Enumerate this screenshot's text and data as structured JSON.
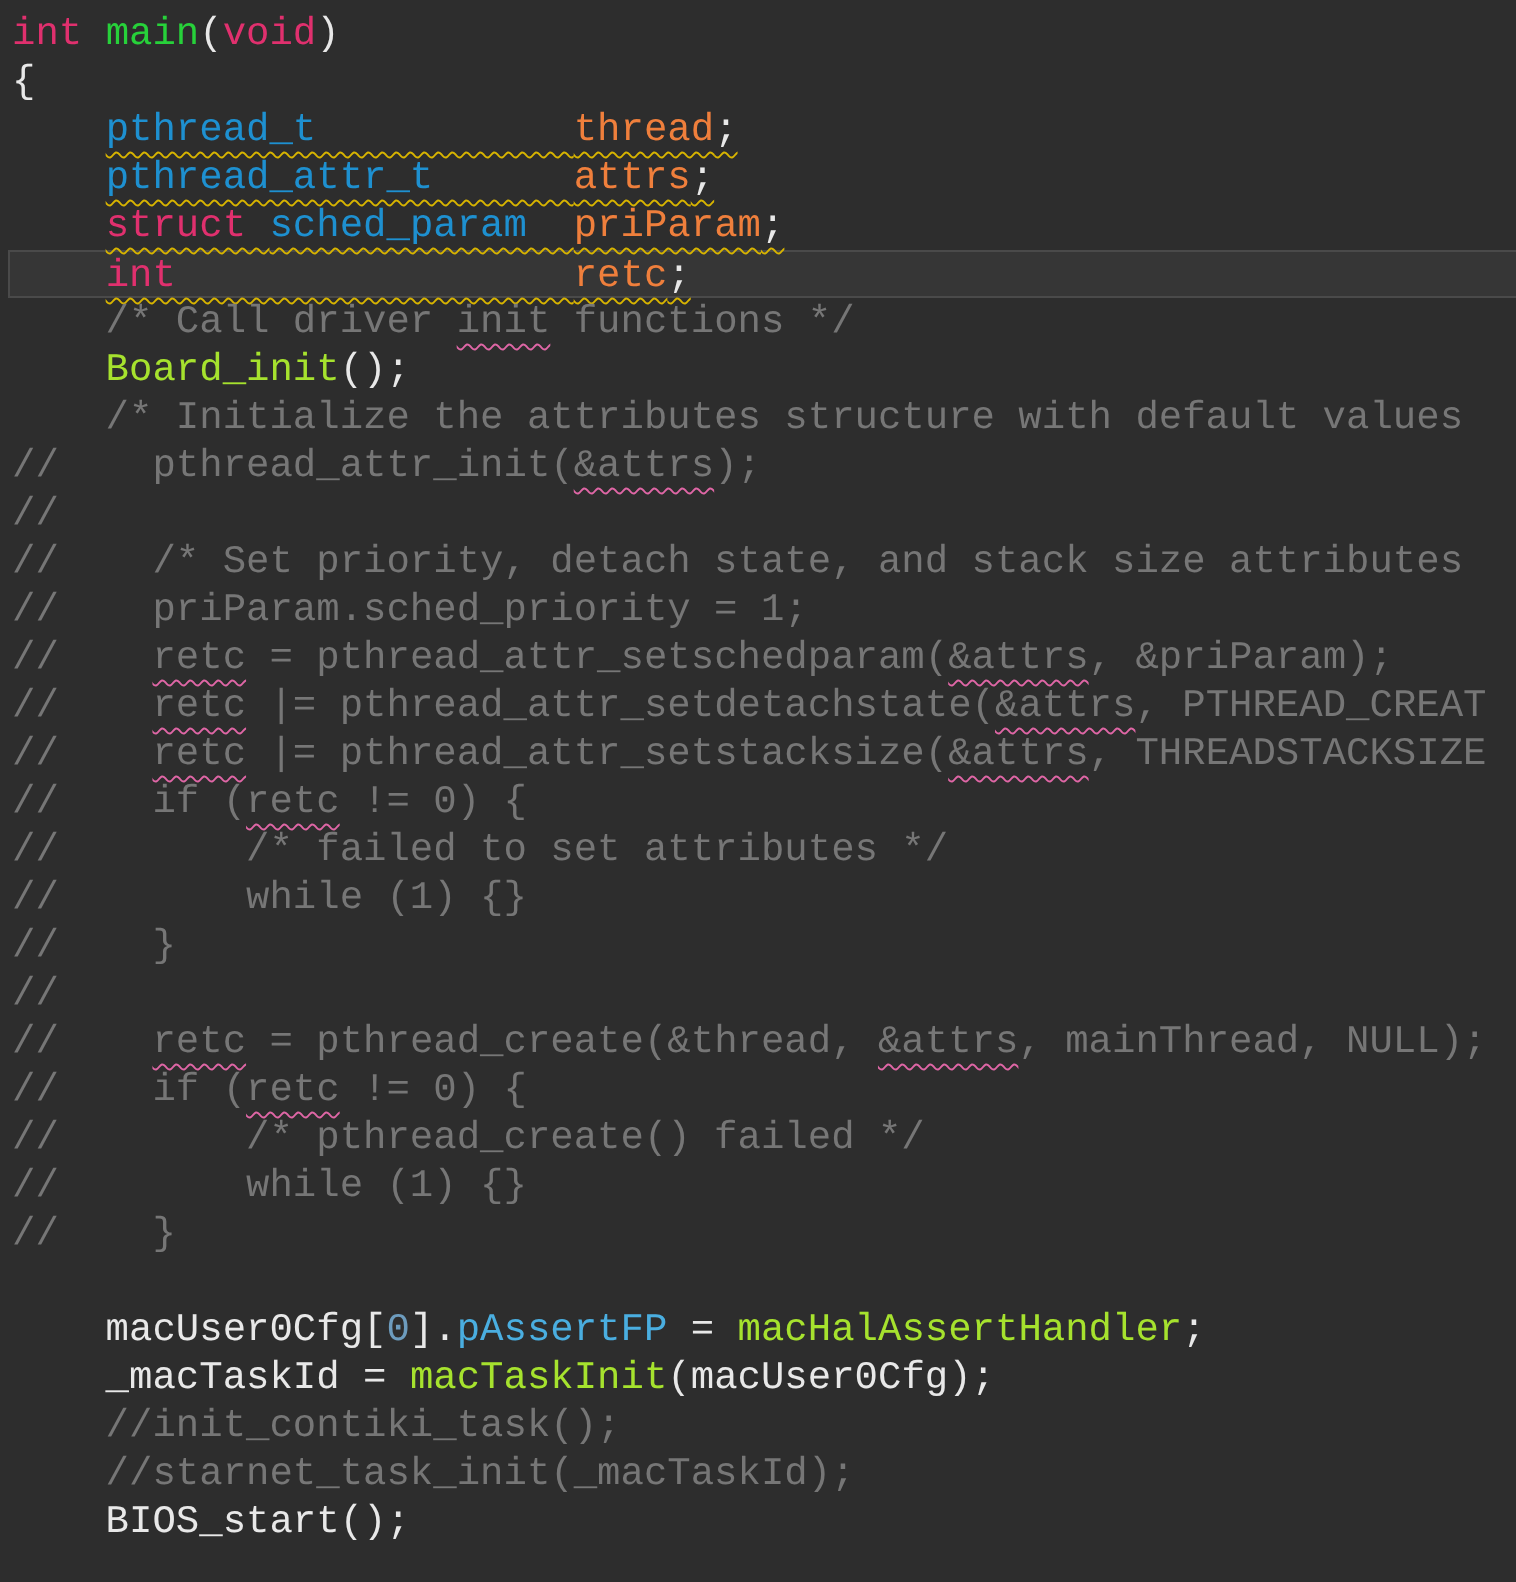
{
  "editor": {
    "lines": [
      {
        "current": false,
        "tokens": [
          {
            "text": "int ",
            "kind": "keyword"
          },
          {
            "text": "main",
            "kind": "definition"
          },
          {
            "text": "(",
            "kind": "plain"
          },
          {
            "text": "void",
            "kind": "keyword"
          },
          {
            "text": ")",
            "kind": "plain"
          }
        ]
      },
      {
        "current": false,
        "tokens": [
          {
            "text": "{",
            "kind": "plain"
          }
        ]
      },
      {
        "current": false,
        "warning": true,
        "tokens": [
          {
            "text": "    pthread_t           ",
            "kind": "type"
          },
          {
            "text": "thread",
            "kind": "variable"
          },
          {
            "text": ";",
            "kind": "plain"
          }
        ]
      },
      {
        "current": false,
        "warning": true,
        "tokens": [
          {
            "text": "    pthread_attr_t      ",
            "kind": "type"
          },
          {
            "text": "attrs",
            "kind": "variable"
          },
          {
            "text": ";",
            "kind": "plain"
          }
        ]
      },
      {
        "current": false,
        "warning": true,
        "tokens": [
          {
            "text": "    struct ",
            "kind": "keyword"
          },
          {
            "text": "sched_param  ",
            "kind": "type"
          },
          {
            "text": "priParam",
            "kind": "variable"
          },
          {
            "text": ";",
            "kind": "plain"
          }
        ]
      },
      {
        "current": true,
        "warning": true,
        "tokens": [
          {
            "text": "    int                 ",
            "kind": "keyword"
          },
          {
            "text": "retc",
            "kind": "variable"
          },
          {
            "text": ";",
            "kind": "plain"
          }
        ]
      },
      {
        "current": false,
        "tokens": [
          {
            "text": "    /* Call driver ",
            "kind": "comment"
          },
          {
            "text": "init",
            "kind": "comment",
            "misspelled": true
          },
          {
            "text": " functions */",
            "kind": "comment"
          }
        ]
      },
      {
        "current": false,
        "tokens": [
          {
            "text": "    Board_init",
            "kind": "function"
          },
          {
            "text": "();",
            "kind": "plain"
          }
        ]
      },
      {
        "current": false,
        "tokens": [
          {
            "text": "    /* Initialize the attributes structure with default values",
            "kind": "comment"
          }
        ]
      },
      {
        "current": false,
        "tokens": [
          {
            "text": "//    pthread_attr_init(",
            "kind": "comment"
          },
          {
            "text": "&attrs",
            "kind": "comment",
            "misspelled": true
          },
          {
            "text": ");",
            "kind": "comment"
          }
        ]
      },
      {
        "current": false,
        "tokens": [
          {
            "text": "//",
            "kind": "comment"
          }
        ]
      },
      {
        "current": false,
        "tokens": [
          {
            "text": "//    /* Set priority, detach state, and stack size attributes",
            "kind": "comment"
          }
        ]
      },
      {
        "current": false,
        "tokens": [
          {
            "text": "//    priParam.sched_priority = 1;",
            "kind": "comment"
          }
        ]
      },
      {
        "current": false,
        "tokens": [
          {
            "text": "//    ",
            "kind": "comment"
          },
          {
            "text": "retc",
            "kind": "comment",
            "misspelled": true
          },
          {
            "text": " = pthread_attr_setschedparam(",
            "kind": "comment"
          },
          {
            "text": "&attrs",
            "kind": "comment",
            "misspelled": true
          },
          {
            "text": ", &priParam);",
            "kind": "comment"
          }
        ]
      },
      {
        "current": false,
        "tokens": [
          {
            "text": "//    ",
            "kind": "comment"
          },
          {
            "text": "retc",
            "kind": "comment",
            "misspelled": true
          },
          {
            "text": " |= pthread_attr_setdetachstate(",
            "kind": "comment"
          },
          {
            "text": "&attrs",
            "kind": "comment",
            "misspelled": true
          },
          {
            "text": ", PTHREAD_CREAT",
            "kind": "comment"
          }
        ]
      },
      {
        "current": false,
        "tokens": [
          {
            "text": "//    ",
            "kind": "comment"
          },
          {
            "text": "retc",
            "kind": "comment",
            "misspelled": true
          },
          {
            "text": " |= pthread_attr_setstacksize(",
            "kind": "comment"
          },
          {
            "text": "&attrs",
            "kind": "comment",
            "misspelled": true
          },
          {
            "text": ", THREADSTACKSIZE",
            "kind": "comment"
          }
        ]
      },
      {
        "current": false,
        "tokens": [
          {
            "text": "//    if (",
            "kind": "comment"
          },
          {
            "text": "retc",
            "kind": "comment",
            "misspelled": true
          },
          {
            "text": " != 0) {",
            "kind": "comment"
          }
        ]
      },
      {
        "current": false,
        "tokens": [
          {
            "text": "//        /* failed to set attributes */",
            "kind": "comment"
          }
        ]
      },
      {
        "current": false,
        "tokens": [
          {
            "text": "//        while (1) {}",
            "kind": "comment"
          }
        ]
      },
      {
        "current": false,
        "tokens": [
          {
            "text": "//    }",
            "kind": "comment"
          }
        ]
      },
      {
        "current": false,
        "tokens": [
          {
            "text": "//",
            "kind": "comment"
          }
        ]
      },
      {
        "current": false,
        "tokens": [
          {
            "text": "//    ",
            "kind": "comment"
          },
          {
            "text": "retc",
            "kind": "comment",
            "misspelled": true
          },
          {
            "text": " = pthread_create(&thread, ",
            "kind": "comment"
          },
          {
            "text": "&attrs",
            "kind": "comment",
            "misspelled": true
          },
          {
            "text": ", mainThread, NULL);",
            "kind": "comment"
          }
        ]
      },
      {
        "current": false,
        "tokens": [
          {
            "text": "//    if (",
            "kind": "comment"
          },
          {
            "text": "retc",
            "kind": "comment",
            "misspelled": true
          },
          {
            "text": " != 0) {",
            "kind": "comment"
          }
        ]
      },
      {
        "current": false,
        "tokens": [
          {
            "text": "//        /* pthread_create() failed */",
            "kind": "comment"
          }
        ]
      },
      {
        "current": false,
        "tokens": [
          {
            "text": "//        while (1) {}",
            "kind": "comment"
          }
        ]
      },
      {
        "current": false,
        "tokens": [
          {
            "text": "//    }",
            "kind": "comment"
          }
        ]
      },
      {
        "current": false
      },
      {
        "current": false,
        "tokens": [
          {
            "text": "    macUser0Cfg[",
            "kind": "plain"
          },
          {
            "text": "0",
            "kind": "number"
          },
          {
            "text": "].",
            "kind": "plain"
          },
          {
            "text": "pAssertFP",
            "kind": "field"
          },
          {
            "text": " = ",
            "kind": "plain"
          },
          {
            "text": "macHalAssertHandler",
            "kind": "function"
          },
          {
            "text": ";",
            "kind": "plain"
          }
        ]
      },
      {
        "current": false,
        "tokens": [
          {
            "text": "    _macTaskId = ",
            "kind": "plain"
          },
          {
            "text": "macTaskInit",
            "kind": "function"
          },
          {
            "text": "(macUser0Cfg);",
            "kind": "plain"
          }
        ]
      },
      {
        "current": false,
        "tokens": [
          {
            "text": "    //init_contiki_task();",
            "kind": "comment"
          }
        ]
      },
      {
        "current": false,
        "tokens": [
          {
            "text": "    //starnet_task_init(_macTaskId);",
            "kind": "comment"
          }
        ]
      },
      {
        "current": false,
        "tokens": [
          {
            "text": "    BIOS_start();",
            "kind": "plain"
          }
        ]
      }
    ]
  }
}
